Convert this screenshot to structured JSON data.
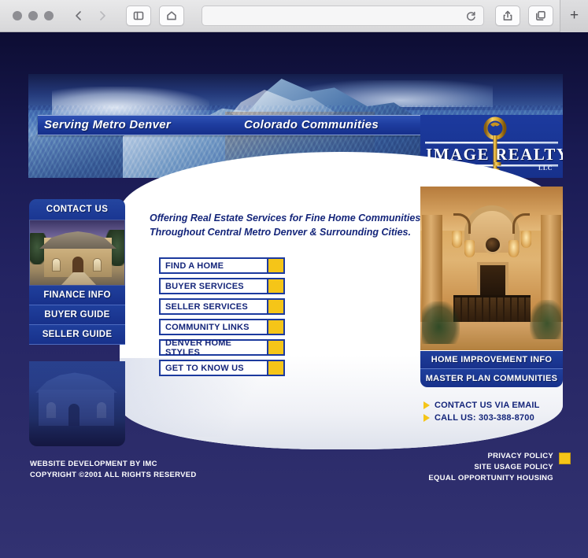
{
  "browser": {
    "url_value": "",
    "url_placeholder": "",
    "back_icon": "back-chevron-icon",
    "forward_icon": "forward-chevron-icon",
    "sidebar_icon": "sidebar-toggle-icon",
    "home_icon": "home-icon",
    "reload_icon": "reload-icon",
    "share_icon": "share-icon",
    "tabs_icon": "tab-overview-icon",
    "newtab_label": "+"
  },
  "banner": {
    "left_text": "Serving Metro Denver",
    "right_text": "Colorado Communities"
  },
  "logo": {
    "word_left": "IMAGE",
    "word_right": "REALTY",
    "suffix": "LLC",
    "key_icon": "ornate-key-icon"
  },
  "main": {
    "tagline_line1": "Offering Real Estate Services for Fine Home Communities",
    "tagline_line2": "Throughout Central Metro Denver & Surrounding Cities.",
    "menu_buttons": [
      {
        "label": "FIND A HOME"
      },
      {
        "label": "BUYER SERVICES"
      },
      {
        "label": "SELLER SERVICES"
      },
      {
        "label": "COMMUNITY LINKS"
      },
      {
        "label": "DENVER HOME STYLES"
      },
      {
        "label": "GET TO KNOW US"
      }
    ]
  },
  "sidebar": {
    "header": "CONTACT US",
    "photo_alt": "brick-house-photo",
    "items": [
      {
        "label": "FINANCE INFO"
      },
      {
        "label": "BUYER GUIDE"
      },
      {
        "label": "SELLER GUIDE"
      }
    ],
    "lower_photo_alt": "blue-tinted-house-photo"
  },
  "right_column": {
    "photo_alt": "interior-corridor-photo",
    "bars": [
      {
        "label": "HOME IMPROVEMENT INFO"
      },
      {
        "label": "MASTER PLAN COMMUNITIES"
      }
    ],
    "links": [
      {
        "label": "CONTACT US VIA EMAIL",
        "bullet": "gold-triangle-icon"
      },
      {
        "label": "CALL US: 303-388-8700",
        "bullet": "gold-triangle-icon"
      }
    ]
  },
  "footer": {
    "left_line1": "WEBSITE DEVELOPMENT BY IMC",
    "left_line2": "COPYRIGHT ©2001 ALL RIGHTS RESERVED",
    "right_line1": "PRIVACY POLICY",
    "right_line2": "SITE USAGE POLICY",
    "right_line3": "EQUAL OPPORTUNITY HOUSING"
  },
  "colors": {
    "page_navy": "#242463",
    "brand_blue": "#1c3a9e",
    "gold": "#f5c518",
    "text_navy": "#14257a"
  }
}
